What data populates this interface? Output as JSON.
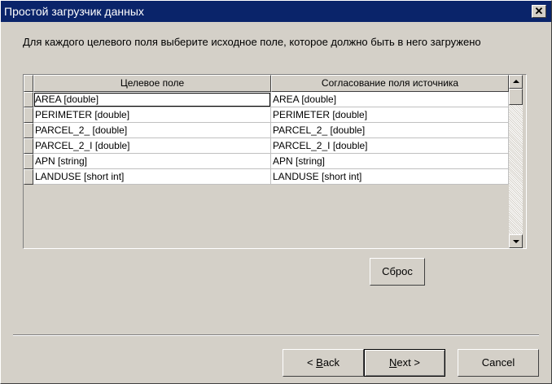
{
  "window": {
    "title": "Простой загрузчик данных",
    "close_glyph": "✕"
  },
  "instructions": "Для каждого целевого поля выберите исходное поле, которое должно быть в него загружено",
  "grid": {
    "columns": [
      "Целевое поле",
      "Согласование поля источника"
    ],
    "rows": [
      {
        "target": "AREA [double]",
        "source": "AREA [double]"
      },
      {
        "target": "PERIMETER [double]",
        "source": "PERIMETER [double]"
      },
      {
        "target": "PARCEL_2_ [double]",
        "source": "PARCEL_2_ [double]"
      },
      {
        "target": "PARCEL_2_I [double]",
        "source": "PARCEL_2_I [double]"
      },
      {
        "target": "APN [string]",
        "source": "APN [string]"
      },
      {
        "target": "LANDUSE [short int]",
        "source": "LANDUSE [short int]"
      }
    ]
  },
  "buttons": {
    "reset": "Сброс",
    "back": {
      "arrow": "<",
      "mnemonic": "B",
      "rest": "ack"
    },
    "next": {
      "mnemonic": "N",
      "rest": "ext",
      "arrow": ">"
    },
    "cancel": "Cancel"
  }
}
